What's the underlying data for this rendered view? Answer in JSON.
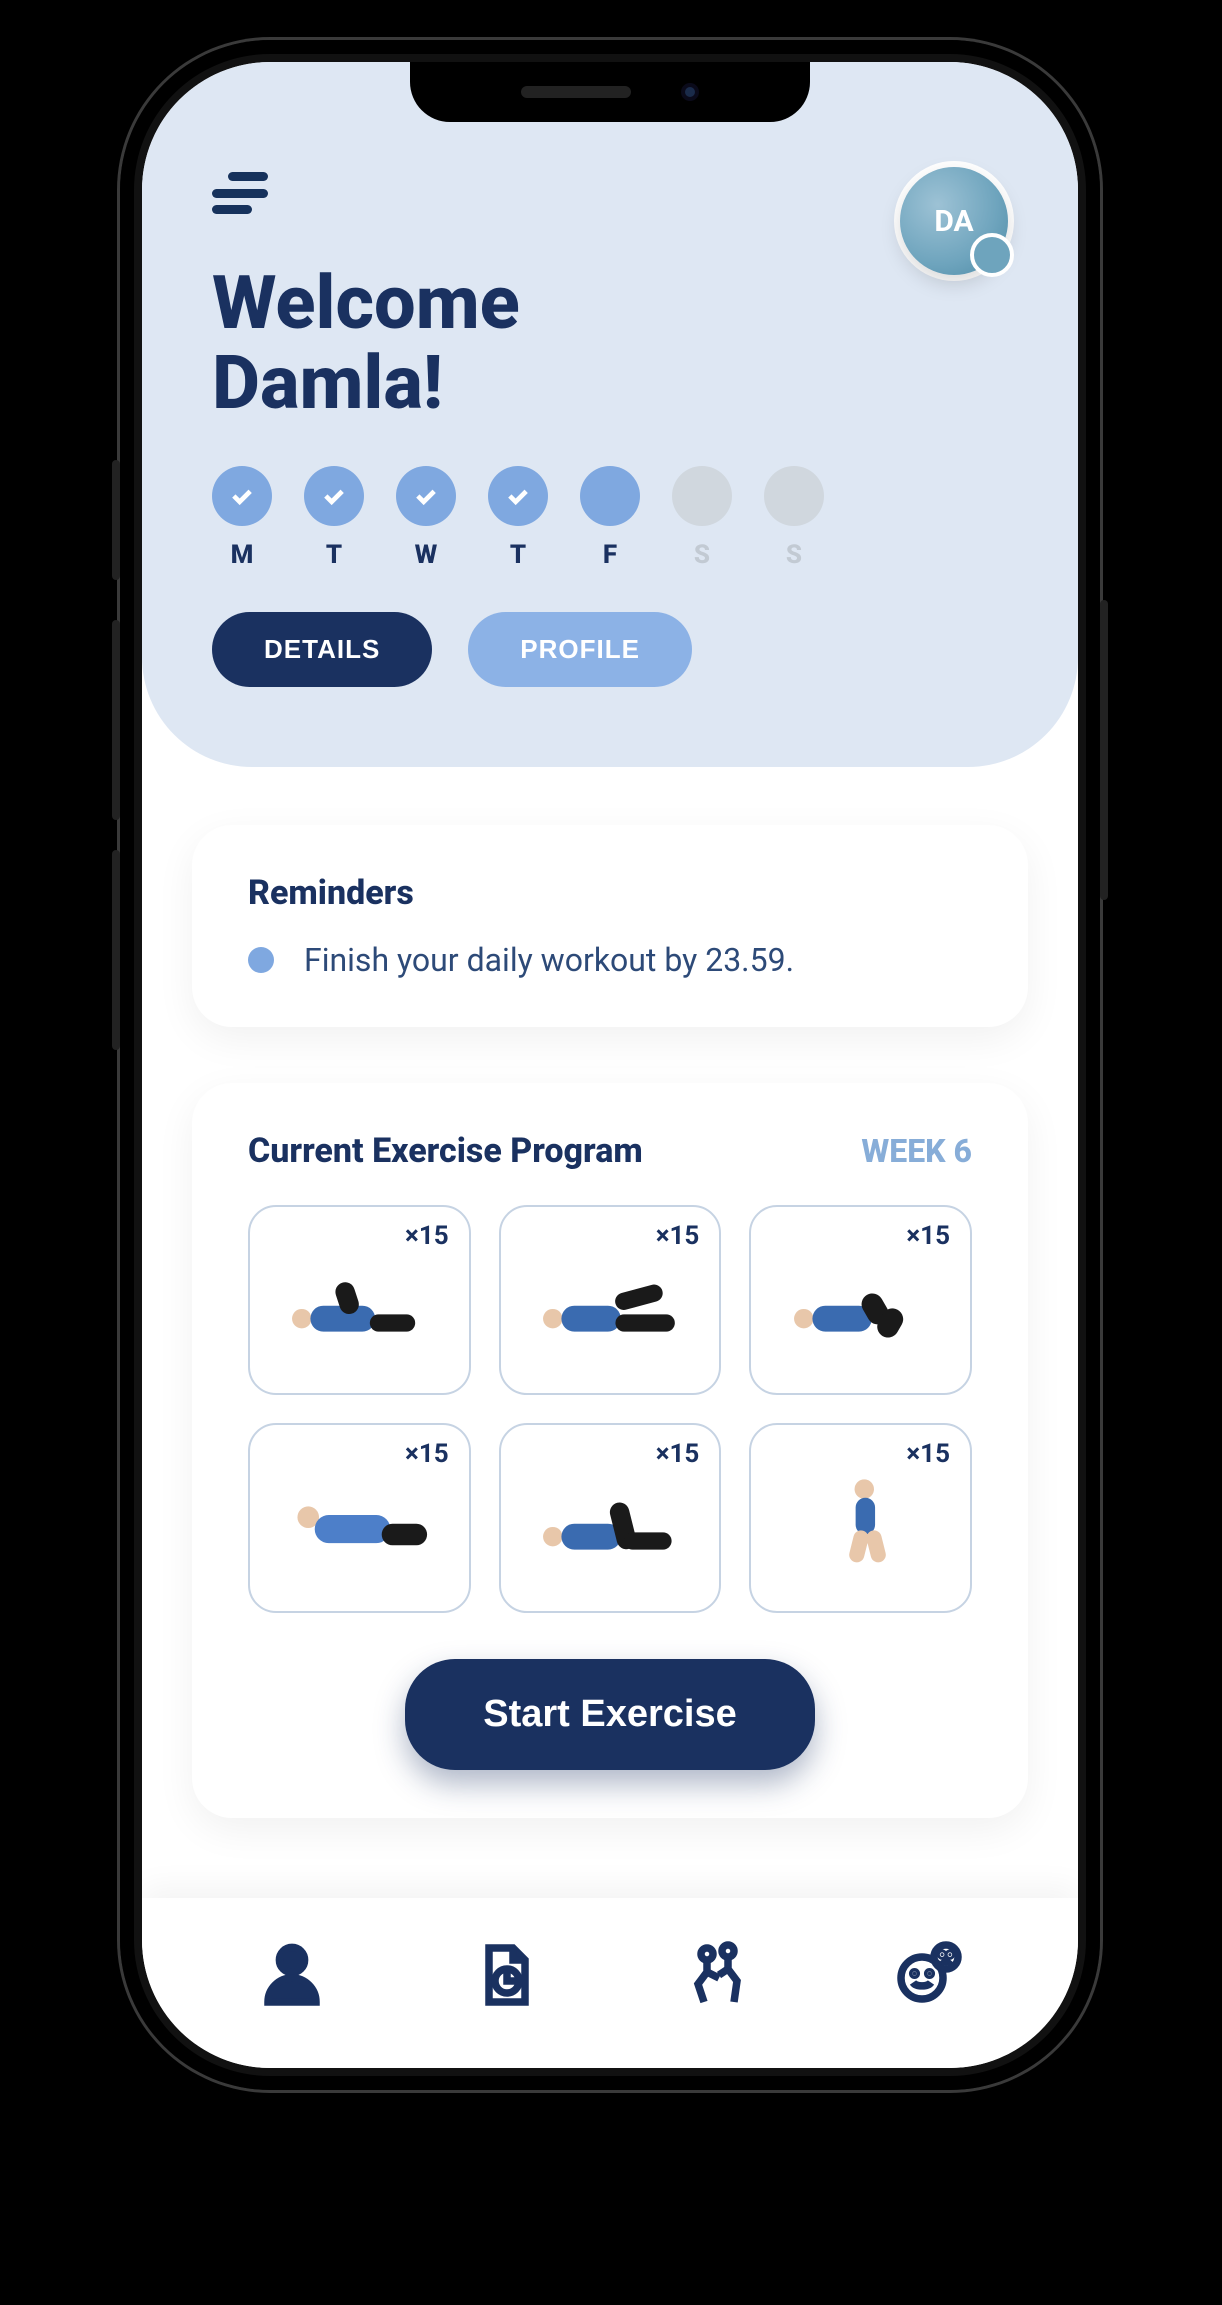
{
  "header": {
    "avatar_initials": "DA",
    "welcome_line1": "Welcome",
    "welcome_line2": "Damla!"
  },
  "week_days": [
    {
      "label": "M",
      "state": "done"
    },
    {
      "label": "T",
      "state": "done"
    },
    {
      "label": "W",
      "state": "done"
    },
    {
      "label": "T",
      "state": "done"
    },
    {
      "label": "F",
      "state": "current"
    },
    {
      "label": "S",
      "state": "future"
    },
    {
      "label": "S",
      "state": "future"
    }
  ],
  "buttons": {
    "details": "DETAILS",
    "profile": "PROFILE",
    "start": "Start Exercise"
  },
  "reminders": {
    "title": "Reminders",
    "items": [
      "Finish your daily workout by 23.59."
    ]
  },
  "program": {
    "title": "Current Exercise Program",
    "week_label": "WEEK 6",
    "exercises": [
      {
        "reps": "×15",
        "pose": "lying-knee-up"
      },
      {
        "reps": "×15",
        "pose": "lying-leg-extend"
      },
      {
        "reps": "×15",
        "pose": "lying-knee-bent"
      },
      {
        "reps": "×15",
        "pose": "side-lying"
      },
      {
        "reps": "×15",
        "pose": "lying-leg-raise"
      },
      {
        "reps": "×15",
        "pose": "walking"
      }
    ]
  },
  "colors": {
    "primary": "#1a3160",
    "accent": "#7fa8e0",
    "hero_bg": "#dee7f3"
  }
}
